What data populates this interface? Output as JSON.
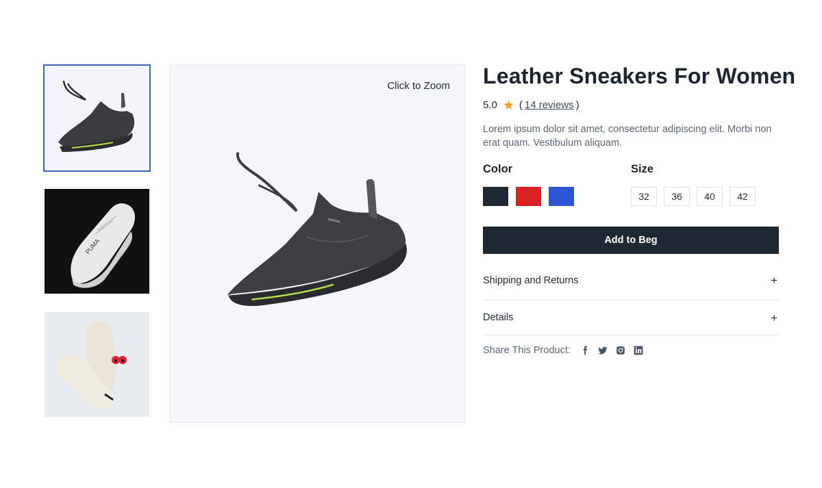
{
  "gallery": {
    "zoom_hint": "Click to Zoom",
    "thumbnails": [
      {
        "icon": "black-running-sneaker-image",
        "active": true
      },
      {
        "icon": "white-leather-sneaker-image",
        "active": false
      },
      {
        "icon": "canvas-high-top-sneakers-image",
        "active": false
      }
    ]
  },
  "product": {
    "title": "Leather Sneakers For Women",
    "rating": "5.0",
    "reviews_open": "(",
    "reviews_link": "14 reviews",
    "reviews_close": ")",
    "description": "Lorem ipsum dolor sit amet, consectetur adipiscing elit. Morbi non erat quam. Vestibulum aliquam.",
    "color_label": "Color",
    "size_label": "Size",
    "colors": [
      "#1f2933",
      "#d92222",
      "#2d56d6"
    ],
    "sizes": [
      "32",
      "36",
      "40",
      "42"
    ],
    "add_button": "Add to Beg",
    "accordion": [
      {
        "label": "Shipping and Returns",
        "icon": "+"
      },
      {
        "label": "Details",
        "icon": "+"
      }
    ],
    "share_label": "Share This Product:",
    "social_icons": [
      "facebook-icon",
      "twitter-icon",
      "instagram-icon",
      "linkedin-icon"
    ]
  },
  "colors": {
    "accent_star": "#f5a623",
    "button_bg": "#1e2833",
    "active_thumb_border": "#3a64b8"
  }
}
